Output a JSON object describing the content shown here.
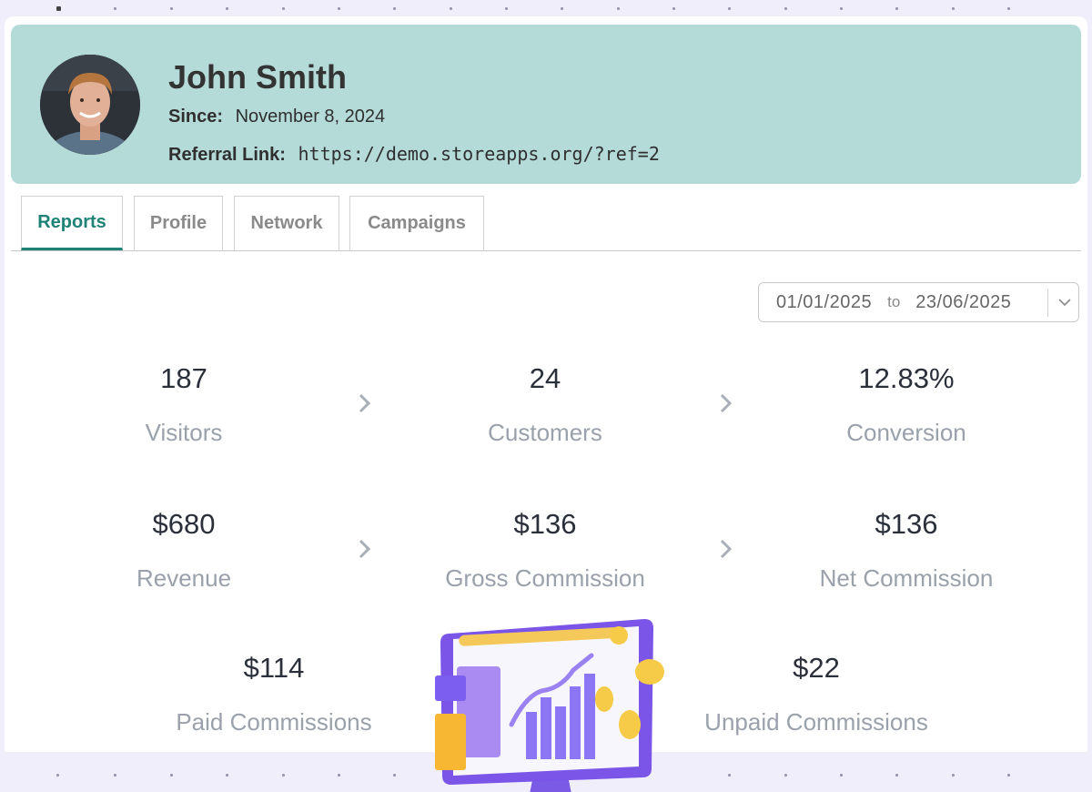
{
  "user": {
    "name": "John Smith",
    "since_label": "Since:",
    "since_value": "November 8, 2024",
    "referral_label": "Referral Link:",
    "referral_value": "https://demo.storeapps.org/?ref=2"
  },
  "tabs": [
    {
      "label": "Reports",
      "active": true
    },
    {
      "label": "Profile",
      "active": false
    },
    {
      "label": "Network",
      "active": false
    },
    {
      "label": "Campaigns",
      "active": false
    }
  ],
  "date_range": {
    "from": "01/01/2025",
    "to_label": "to",
    "to": "23/06/2025"
  },
  "stats": {
    "visitors": {
      "value": "187",
      "label": "Visitors"
    },
    "customers": {
      "value": "24",
      "label": "Customers"
    },
    "conversion": {
      "value": "12.83%",
      "label": "Conversion"
    },
    "revenue": {
      "value": "$680",
      "label": "Revenue"
    },
    "gross_commission": {
      "value": "$136",
      "label": "Gross Commission"
    },
    "net_commission": {
      "value": "$136",
      "label": "Net Commission"
    },
    "paid_commissions": {
      "value": "$114",
      "label": "Paid Commissions"
    },
    "unpaid_commissions": {
      "value": "$22",
      "label": "Unpaid Commissions"
    }
  },
  "colors": {
    "header_bg": "#b5dbd9",
    "accent": "#1e8277",
    "page_bg": "#efeefa"
  }
}
